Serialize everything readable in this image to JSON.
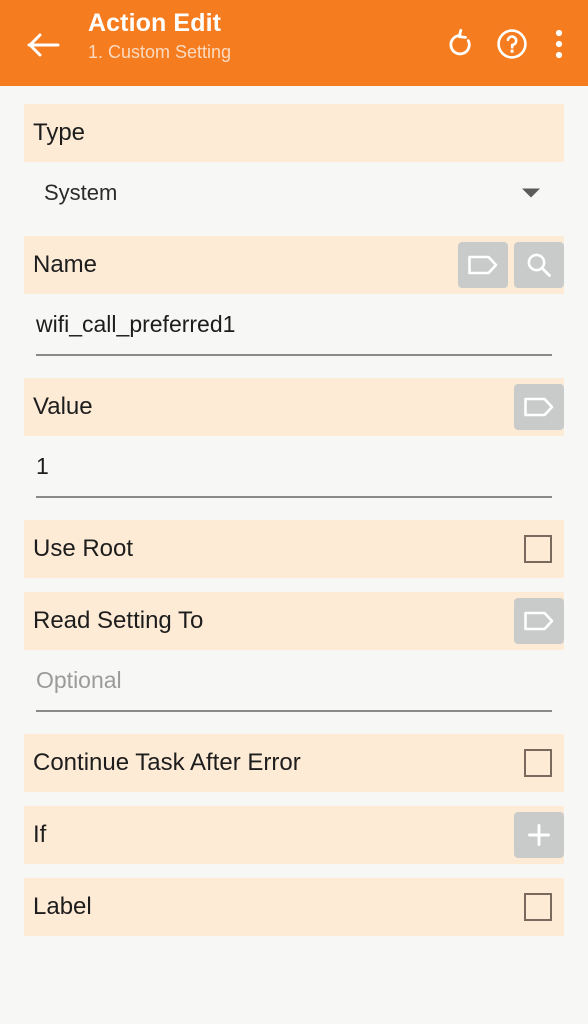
{
  "appbar": {
    "back_icon": "arrow-left-icon",
    "title": "Action Edit",
    "subtitle": "1. Custom Setting",
    "actions": [
      {
        "icon": "undo-refresh-icon",
        "name": "undo-button"
      },
      {
        "icon": "help-circle-icon",
        "name": "help-button"
      },
      {
        "icon": "overflow-menu-icon",
        "name": "overflow-menu-button"
      }
    ],
    "background_color": "#f57c1f",
    "title_color": "#ffffff"
  },
  "theme": {
    "header_row_color": "#fdebd6",
    "page_background": "#f7f7f5",
    "icon_button_color": "#c9cbcb",
    "underline_color": "#8a8a8a",
    "checkbox_border_color": "#7a6a5d"
  },
  "fields": {
    "type": {
      "label": "Type",
      "selected": "System",
      "options": [
        "System"
      ]
    },
    "name": {
      "label": "Name",
      "value": "wifi_call_preferred1",
      "placeholder": "",
      "tag_button_icon": "tag-icon",
      "search_button_icon": "search-icon"
    },
    "value": {
      "label": "Value",
      "value": "1",
      "placeholder": "",
      "tag_button_icon": "tag-icon"
    },
    "use_root": {
      "label": "Use Root",
      "checked": false
    },
    "read_setting_to": {
      "label": "Read Setting To",
      "value": "",
      "placeholder": "Optional",
      "tag_button_icon": "tag-icon"
    },
    "continue_task_after_error": {
      "label": "Continue Task After Error",
      "checked": false
    },
    "if": {
      "label": "If",
      "add_button_icon": "plus-icon"
    },
    "label": {
      "label": "Label",
      "checked": false
    }
  }
}
